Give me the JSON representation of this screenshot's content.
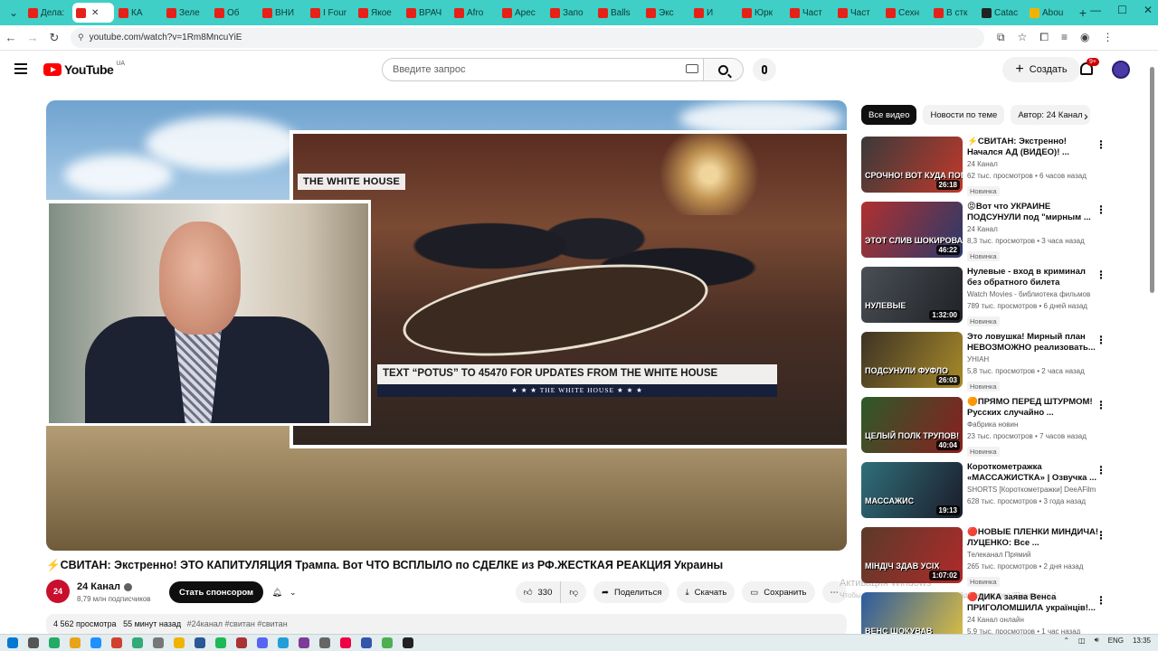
{
  "browser": {
    "tabs": [
      {
        "label": "Дела:",
        "active": false
      },
      {
        "label": "",
        "active": true
      },
      {
        "label": "КА",
        "active": false
      },
      {
        "label": "Зеле",
        "active": false
      },
      {
        "label": "Об",
        "active": false
      },
      {
        "label": "ВНИ",
        "active": false
      },
      {
        "label": "I Four",
        "active": false
      },
      {
        "label": "Якое",
        "active": false
      },
      {
        "label": "ВРАЧ",
        "active": false
      },
      {
        "label": "Afro",
        "active": false
      },
      {
        "label": "Арес",
        "active": false
      },
      {
        "label": "Запо",
        "active": false
      },
      {
        "label": "Balls",
        "active": false
      },
      {
        "label": "Экс",
        "active": false
      },
      {
        "label": "И",
        "active": false
      },
      {
        "label": "Юрк",
        "active": false
      },
      {
        "label": "Част",
        "active": false
      },
      {
        "label": "Част",
        "active": false
      },
      {
        "label": "Сехн",
        "active": false
      },
      {
        "label": "В стк",
        "active": false
      },
      {
        "label": "Catac",
        "active": false
      },
      {
        "label": "Abou",
        "active": false
      }
    ],
    "close_glyph": "✕",
    "newtab_glyph": "+",
    "url": "youtube.com/watch?v=1Rm8MncuYiE"
  },
  "masthead": {
    "logo_text": "YouTube",
    "country_code": "UA",
    "search_placeholder": "Введите запрос",
    "create_label": "Создать",
    "notifications_badge": "9+"
  },
  "player": {
    "inset_label": "THE WHITE HOUSE",
    "lower_third_text": "TEXT “POTUS” TO 45470 FOR UPDATES FROM THE WHITE HOUSE",
    "lower_third_sub": "★ ★ ★   THE WHITE HOUSE   ★ ★ ★"
  },
  "video": {
    "title": "⚡️СВИТАН: Экстренно! ЭТО КАПИТУЛЯЦИЯ Трампа. Вот ЧТО ВСПЛЫЛО по СДЕЛКЕ из РФ.ЖЕСТКАЯ РЕАКЦИЯ Украины",
    "channel_avatar_text": "24",
    "channel_name": "24 Канал",
    "subscribers": "8,79 млн подписчиков",
    "sponsor_label": "Стать спонсором",
    "likes": "330",
    "share_label": "Поделиться",
    "download_label": "Скачать",
    "save_label": "Сохранить",
    "more_glyph": "⋯",
    "views": "4 562 просмотра",
    "time_ago": "55 минут назад",
    "tags": "#24канал #свитан #свитан"
  },
  "activation": {
    "title": "Активация Windows",
    "subtitle": "Чтобы активировать Windows, перейдите в раздел \"Параметры\"."
  },
  "sidebar": {
    "chips": [
      "Все видео",
      "Новости по теме",
      "Автор: 24 Канал"
    ],
    "next_glyph": "›",
    "recommendations": [
      {
        "title": "⚡️СВИТАН: Экстренно! Начался АД (ВИДЕО)! ...",
        "channel": "24 Канал",
        "meta": "62 тыс. просмотров • 6 часов назад",
        "badge": "Новинка",
        "duration": "26:18",
        "caption": "СРОЧНО! ВОТ КУДА ПОПАЛ МАДЯР!",
        "c1": "#3a3a3a",
        "c2": "#c0392b"
      },
      {
        "title": "😡Вот что УКРАИНЕ ПОДСУНУЛИ под \"мирным ...",
        "channel": "24 Канал",
        "meta": "8,3 тыс. просмотров • 3 часа назад",
        "badge": "Новинка",
        "duration": "46:22",
        "caption": "ЭТОТ СЛИВ ШОКИРОВАЛ ВСЕ",
        "c1": "#b03030",
        "c2": "#2a3a6a"
      },
      {
        "title": "Нулевые - вход в криминал без обратного билета",
        "channel": "Watch Movies - библиотека фильмов",
        "meta": "789 тыс. просмотров • 6 дней назад",
        "badge": "Новинка",
        "duration": "1:32:00",
        "caption": "НУЛЕВЫЕ",
        "c1": "#4a4f55",
        "c2": "#1f2226"
      },
      {
        "title": "Это ловушка! Мирный план НЕВОЗМОЖНО реализовать...",
        "channel": "УНІАН",
        "meta": "5,8 тыс. просмотров • 2 часа назад",
        "badge": "Новинка",
        "duration": "26:03",
        "caption": "ПОДСУНУЛИ ФУФЛО",
        "c1": "#3d3324",
        "c2": "#a88a2a"
      },
      {
        "title": "🟠ПРЯМО ПЕРЕД ШТУРМОМ! Русских случайно ...",
        "channel": "Фабрика новин",
        "meta": "23 тыс. просмотров • 7 часов назад",
        "badge": "Новинка",
        "duration": "40:04",
        "caption": "ЦЕЛЫЙ ПОЛК ТРУПОВ!",
        "c1": "#2d5a2a",
        "c2": "#8a1f1f"
      },
      {
        "title": "Короткометражка «МАССАЖИСТКА» | Озвучка ...",
        "channel": "SHORTS [Короткометражки] DeeAFilm",
        "meta": "628 тыс. просмотров • 3 года назад",
        "badge": "",
        "duration": "19:13",
        "caption": "МАССАЖИС",
        "c1": "#2f6f7a",
        "c2": "#1c1c2a"
      },
      {
        "title": "🔴НОВЫЕ ПЛЕНКИ МИНДИЧА! ЛУЦЕНКО: Все ...",
        "channel": "Телеканал Прямий",
        "meta": "265 тыс. просмотров • 2 дня назад",
        "badge": "Новинка",
        "duration": "1:07:02",
        "caption": "МІНДІЧ ЗДАВ УСІХ",
        "c1": "#5a3a2a",
        "c2": "#b02a2a"
      },
      {
        "title": "🔴ДИКА заява Венса ПРИГОЛОМШИЛА українців!...",
        "channel": "24 Канал онлайн",
        "meta": "5,9 тыс. просмотров • 1 час назад",
        "badge": "",
        "duration": "",
        "caption": "ВЕНС ШОКУВАВ",
        "c1": "#2a5aa0",
        "c2": "#e0c040"
      }
    ]
  },
  "taskbar": {
    "lang": "ENG",
    "time": "13:35"
  },
  "colors": {
    "tabstrip": "#3fcfc6",
    "yt_red": "#ff0000",
    "sponsor_bg": "#0f0f0f"
  }
}
